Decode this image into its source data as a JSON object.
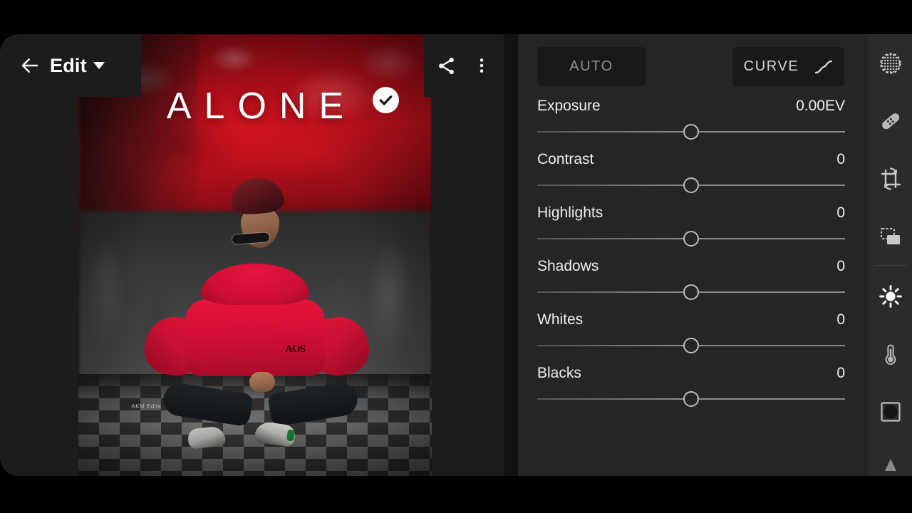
{
  "app": {
    "screen_title": "Edit",
    "photo_overlay_text": "ALONE",
    "watermark": "AKM Edits"
  },
  "header": {
    "back_icon": "back-arrow-icon",
    "edit_label": "Edit",
    "dropdown_icon": "chevron-down-icon",
    "done_icon": "check-circle-icon",
    "share_icon": "share-icon",
    "more_icon": "more-vertical-icon"
  },
  "panel": {
    "auto_label": "AUTO",
    "curve_label": "CURVE",
    "curve_icon": "tone-curve-icon",
    "sliders": [
      {
        "label": "Exposure",
        "value": "0.00EV",
        "position_pct": 50
      },
      {
        "label": "Contrast",
        "value": "0",
        "position_pct": 50
      },
      {
        "label": "Highlights",
        "value": "0",
        "position_pct": 50
      },
      {
        "label": "Shadows",
        "value": "0",
        "position_pct": 50
      },
      {
        "label": "Whites",
        "value": "0",
        "position_pct": 50
      },
      {
        "label": "Blacks",
        "value": "0",
        "position_pct": 50
      }
    ]
  },
  "tool_rail": {
    "items": [
      {
        "name": "selective-icon",
        "label": "Selective"
      },
      {
        "name": "healing-icon",
        "label": "Healing"
      },
      {
        "name": "crop-rotate-icon",
        "label": "Crop"
      },
      {
        "name": "presets-icon",
        "label": "Presets"
      },
      {
        "name": "light-icon",
        "label": "Light",
        "active": true
      },
      {
        "name": "color-icon",
        "label": "Color"
      },
      {
        "name": "effects-icon",
        "label": "Effects"
      }
    ],
    "expand_icon": "expand-up-icon"
  },
  "colors": {
    "window_bg": "#1c1c1c",
    "panel_bg": "#252525",
    "rail_bg": "#2b2b2b",
    "accent_red": "#d41420",
    "text_primary": "#efefef",
    "text_muted": "#8e8e8e"
  }
}
